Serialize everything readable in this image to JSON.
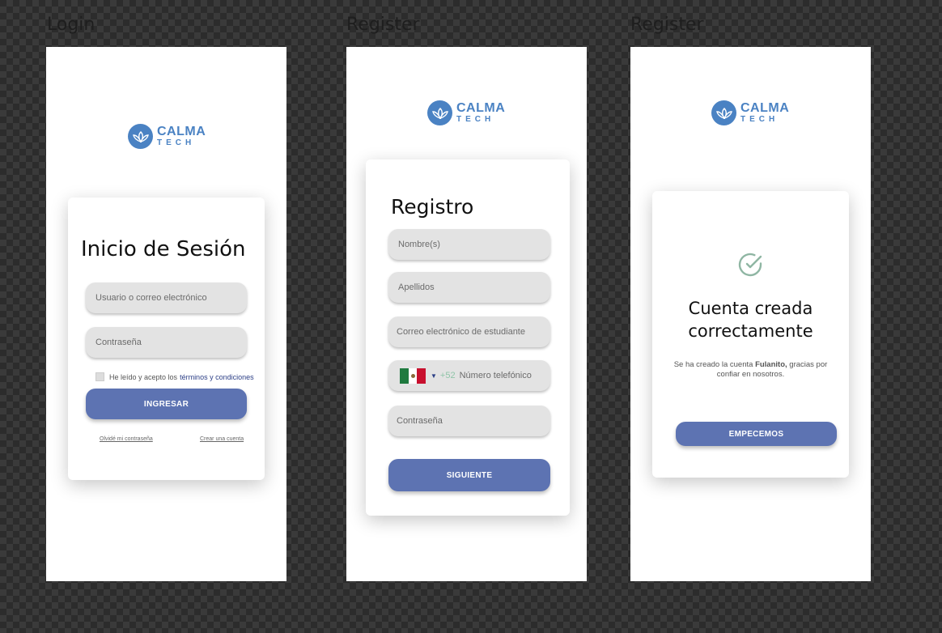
{
  "frames": {
    "login_label": "Login",
    "register_label": "Register",
    "success_label": "Register"
  },
  "logo": {
    "line1": "CALMA",
    "line2": "TECH",
    "icon": "lotus-icon",
    "color": "#4a82c3"
  },
  "login": {
    "title": "Inicio de Sesión",
    "username_placeholder": "Usuario o correo electrónico",
    "password_placeholder": "Contraseña",
    "terms_prefix": "He leído y acepto los",
    "terms_link": "términos y condiciones",
    "submit_label": "INGRESAR",
    "forgot_link": "Olvidé mi contraseña",
    "create_link": "Crear una cuenta"
  },
  "register": {
    "title": "Registro",
    "names_placeholder": "Nombre(s)",
    "lastnames_placeholder": "Apellidos",
    "email_placeholder": "Correo electrónico de estudiante",
    "phone_prefix": "+52",
    "phone_placeholder": "Número telefónico",
    "country_flag": "mexico-flag-icon",
    "password_placeholder": "Contraseña",
    "submit_label": "SIGUIENTE"
  },
  "success": {
    "icon": "check-circle-icon",
    "title_line1": "Cuenta creada",
    "title_line2": "correctamente",
    "message_prefix": "Se ha creado la cuenta",
    "account_name": "Fulanito,",
    "message_suffix_line1": "gracias por",
    "message_line2": "confiar en nosotros.",
    "submit_label": "EMPECEMOS"
  },
  "colors": {
    "accent": "#5d73b2",
    "link": "#2c3f86",
    "check": "#8fb6a3"
  }
}
